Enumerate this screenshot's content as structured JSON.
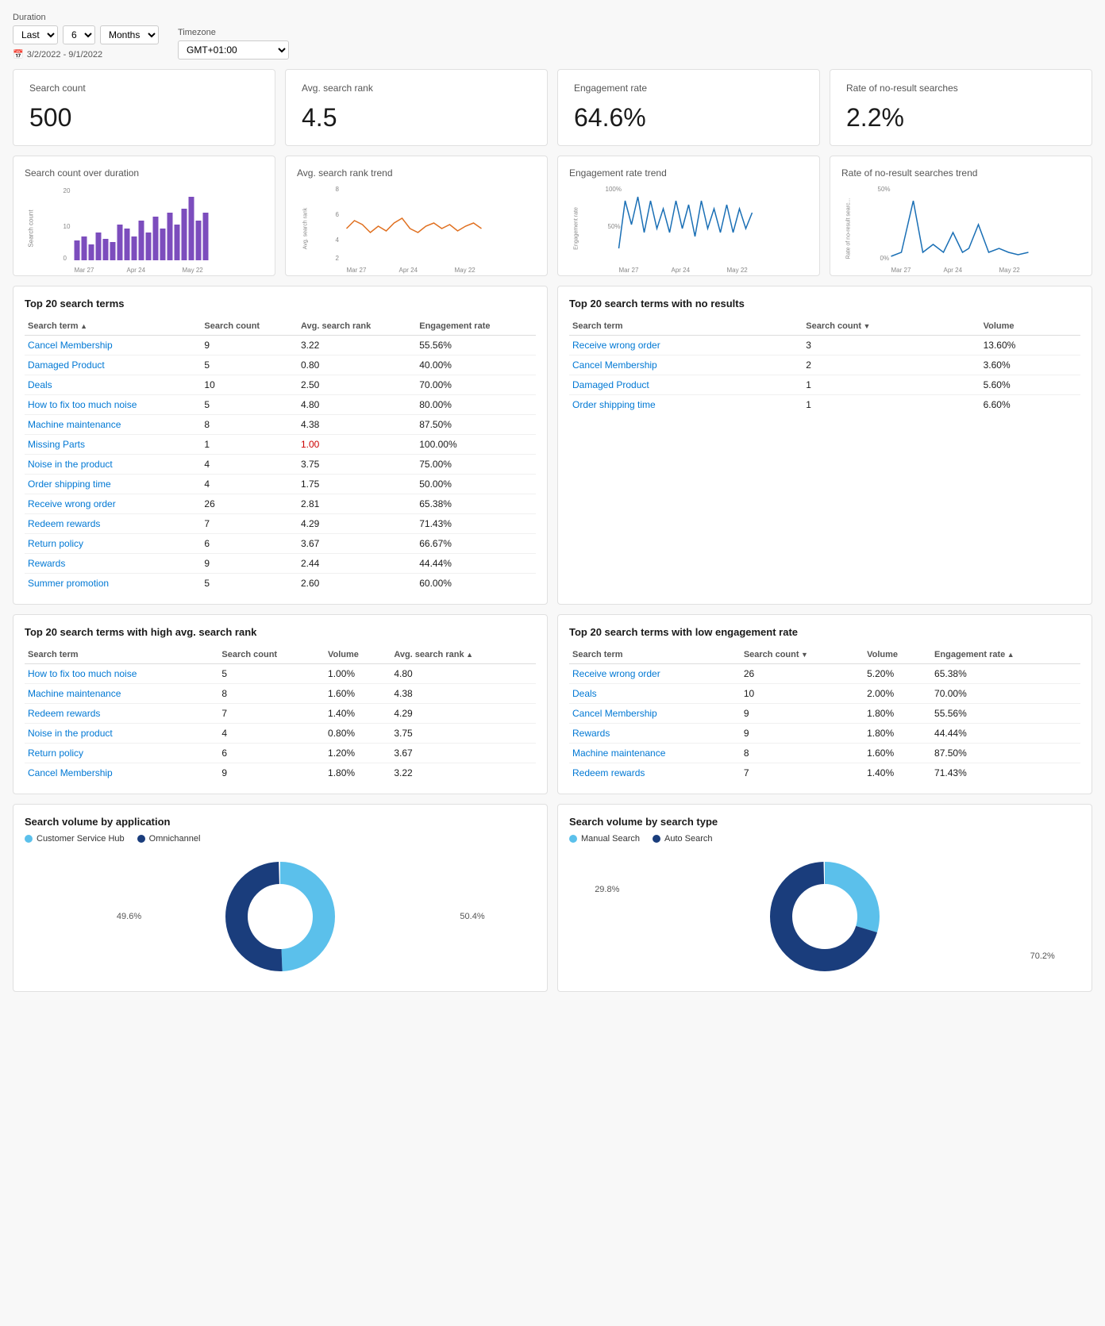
{
  "filters": {
    "duration_label": "Duration",
    "period_type": "Last",
    "period_value": "6",
    "period_unit": "Months",
    "timezone_label": "Timezone",
    "timezone_value": "GMT+01:00",
    "date_range_icon": "📅",
    "date_range": "3/2/2022 - 9/1/2022"
  },
  "metrics": [
    {
      "title": "Search count",
      "value": "500"
    },
    {
      "title": "Avg. search rank",
      "value": "4.5"
    },
    {
      "title": "Engagement rate",
      "value": "64.6%"
    },
    {
      "title": "Rate of no-result searches",
      "value": "2.2%"
    }
  ],
  "chart_titles": [
    "Search count over duration",
    "Avg. search rank trend",
    "Engagement rate trend",
    "Rate of no-result searches trend"
  ],
  "chart_axes": {
    "search_count": {
      "y_max": "20",
      "y_mid": "10",
      "y_min": "0",
      "x_labels": [
        "Mar 27",
        "Apr 24",
        "May 22"
      ]
    },
    "avg_rank": {
      "y_max": "8",
      "y_mid": "6",
      "y_min": "2",
      "x_labels": [
        "Mar 27",
        "Apr 24",
        "May 22"
      ]
    },
    "engagement": {
      "y_max": "100%",
      "y_mid": "50%",
      "x_labels": [
        "Mar 27",
        "Apr 24",
        "May 22"
      ]
    },
    "no_result": {
      "y_max": "50%",
      "y_min": "0%",
      "x_labels": [
        "Mar 27",
        "Apr 24",
        "May 22"
      ]
    }
  },
  "top20_terms": {
    "title": "Top 20 search terms",
    "columns": [
      "Search term",
      "Search count",
      "Avg. search rank",
      "Engagement rate"
    ],
    "rows": [
      {
        "term": "Cancel Membership",
        "count": "9",
        "rank": "3.22",
        "engagement": "55.56%"
      },
      {
        "term": "Damaged Product",
        "count": "5",
        "rank": "0.80",
        "engagement": "40.00%"
      },
      {
        "term": "Deals",
        "count": "10",
        "rank": "2.50",
        "engagement": "70.00%"
      },
      {
        "term": "How to fix too much noise",
        "count": "5",
        "rank": "4.80",
        "engagement": "80.00%"
      },
      {
        "term": "Machine maintenance",
        "count": "8",
        "rank": "4.38",
        "engagement": "87.50%"
      },
      {
        "term": "Missing Parts",
        "count": "1",
        "rank": "1.00",
        "engagement": "100.00%",
        "red_rank": true
      },
      {
        "term": "Noise in the product",
        "count": "4",
        "rank": "3.75",
        "engagement": "75.00%"
      },
      {
        "term": "Order shipping time",
        "count": "4",
        "rank": "1.75",
        "engagement": "50.00%"
      },
      {
        "term": "Receive wrong order",
        "count": "26",
        "rank": "2.81",
        "engagement": "65.38%"
      },
      {
        "term": "Redeem rewards",
        "count": "7",
        "rank": "4.29",
        "engagement": "71.43%"
      },
      {
        "term": "Return policy",
        "count": "6",
        "rank": "3.67",
        "engagement": "66.67%"
      },
      {
        "term": "Rewards",
        "count": "9",
        "rank": "2.44",
        "engagement": "44.44%"
      },
      {
        "term": "Summer promotion",
        "count": "5",
        "rank": "2.60",
        "engagement": "60.00%"
      }
    ]
  },
  "top20_no_results": {
    "title": "Top 20 search terms with no results",
    "columns": [
      "Search term",
      "Search count",
      "Volume"
    ],
    "rows": [
      {
        "term": "Receive wrong order",
        "count": "3",
        "volume": "13.60%"
      },
      {
        "term": "Cancel Membership",
        "count": "2",
        "volume": "3.60%"
      },
      {
        "term": "Damaged Product",
        "count": "1",
        "volume": "5.60%"
      },
      {
        "term": "Order shipping time",
        "count": "1",
        "volume": "6.60%"
      }
    ]
  },
  "top20_high_rank": {
    "title": "Top 20 search terms with high avg. search rank",
    "columns": [
      "Search term",
      "Search count",
      "Volume",
      "Avg. search rank"
    ],
    "rows": [
      {
        "term": "How to fix too much noise",
        "count": "5",
        "volume": "1.00%",
        "rank": "4.80"
      },
      {
        "term": "Machine maintenance",
        "count": "8",
        "volume": "1.60%",
        "rank": "4.38"
      },
      {
        "term": "Redeem rewards",
        "count": "7",
        "volume": "1.40%",
        "rank": "4.29"
      },
      {
        "term": "Noise in the product",
        "count": "4",
        "volume": "0.80%",
        "rank": "3.75"
      },
      {
        "term": "Return policy",
        "count": "6",
        "volume": "1.20%",
        "rank": "3.67"
      },
      {
        "term": "Cancel Membership",
        "count": "9",
        "volume": "1.80%",
        "rank": "3.22"
      }
    ]
  },
  "top20_low_engagement": {
    "title": "Top 20 search terms with low engagement rate",
    "columns": [
      "Search term",
      "Search count",
      "Volume",
      "Engagement rate"
    ],
    "rows": [
      {
        "term": "Receive wrong order",
        "count": "26",
        "volume": "5.20%",
        "engagement": "65.38%"
      },
      {
        "term": "Deals",
        "count": "10",
        "volume": "2.00%",
        "engagement": "70.00%"
      },
      {
        "term": "Cancel Membership",
        "count": "9",
        "volume": "1.80%",
        "engagement": "55.56%"
      },
      {
        "term": "Rewards",
        "count": "9",
        "volume": "1.80%",
        "engagement": "44.44%"
      },
      {
        "term": "Machine maintenance",
        "count": "8",
        "volume": "1.60%",
        "engagement": "87.50%"
      },
      {
        "term": "Redeem rewards",
        "count": "7",
        "volume": "1.40%",
        "engagement": "71.43%"
      }
    ]
  },
  "pie_by_app": {
    "title": "Search volume by application",
    "legend": [
      {
        "label": "Customer Service Hub",
        "color": "#5bc0eb"
      },
      {
        "label": "Omnichannel",
        "color": "#1a3d7c"
      }
    ],
    "segments": [
      {
        "label": "49.6%",
        "value": 49.6,
        "color": "#5bc0eb"
      },
      {
        "label": "50.4%",
        "value": 50.4,
        "color": "#1a3d7c"
      }
    ]
  },
  "pie_by_type": {
    "title": "Search volume by search type",
    "legend": [
      {
        "label": "Manual Search",
        "color": "#5bc0eb"
      },
      {
        "label": "Auto Search",
        "color": "#1a3d7c"
      }
    ],
    "segments": [
      {
        "label": "29.8%",
        "value": 29.8,
        "color": "#5bc0eb"
      },
      {
        "label": "70.2%",
        "value": 70.2,
        "color": "#1a3d7c"
      }
    ]
  }
}
